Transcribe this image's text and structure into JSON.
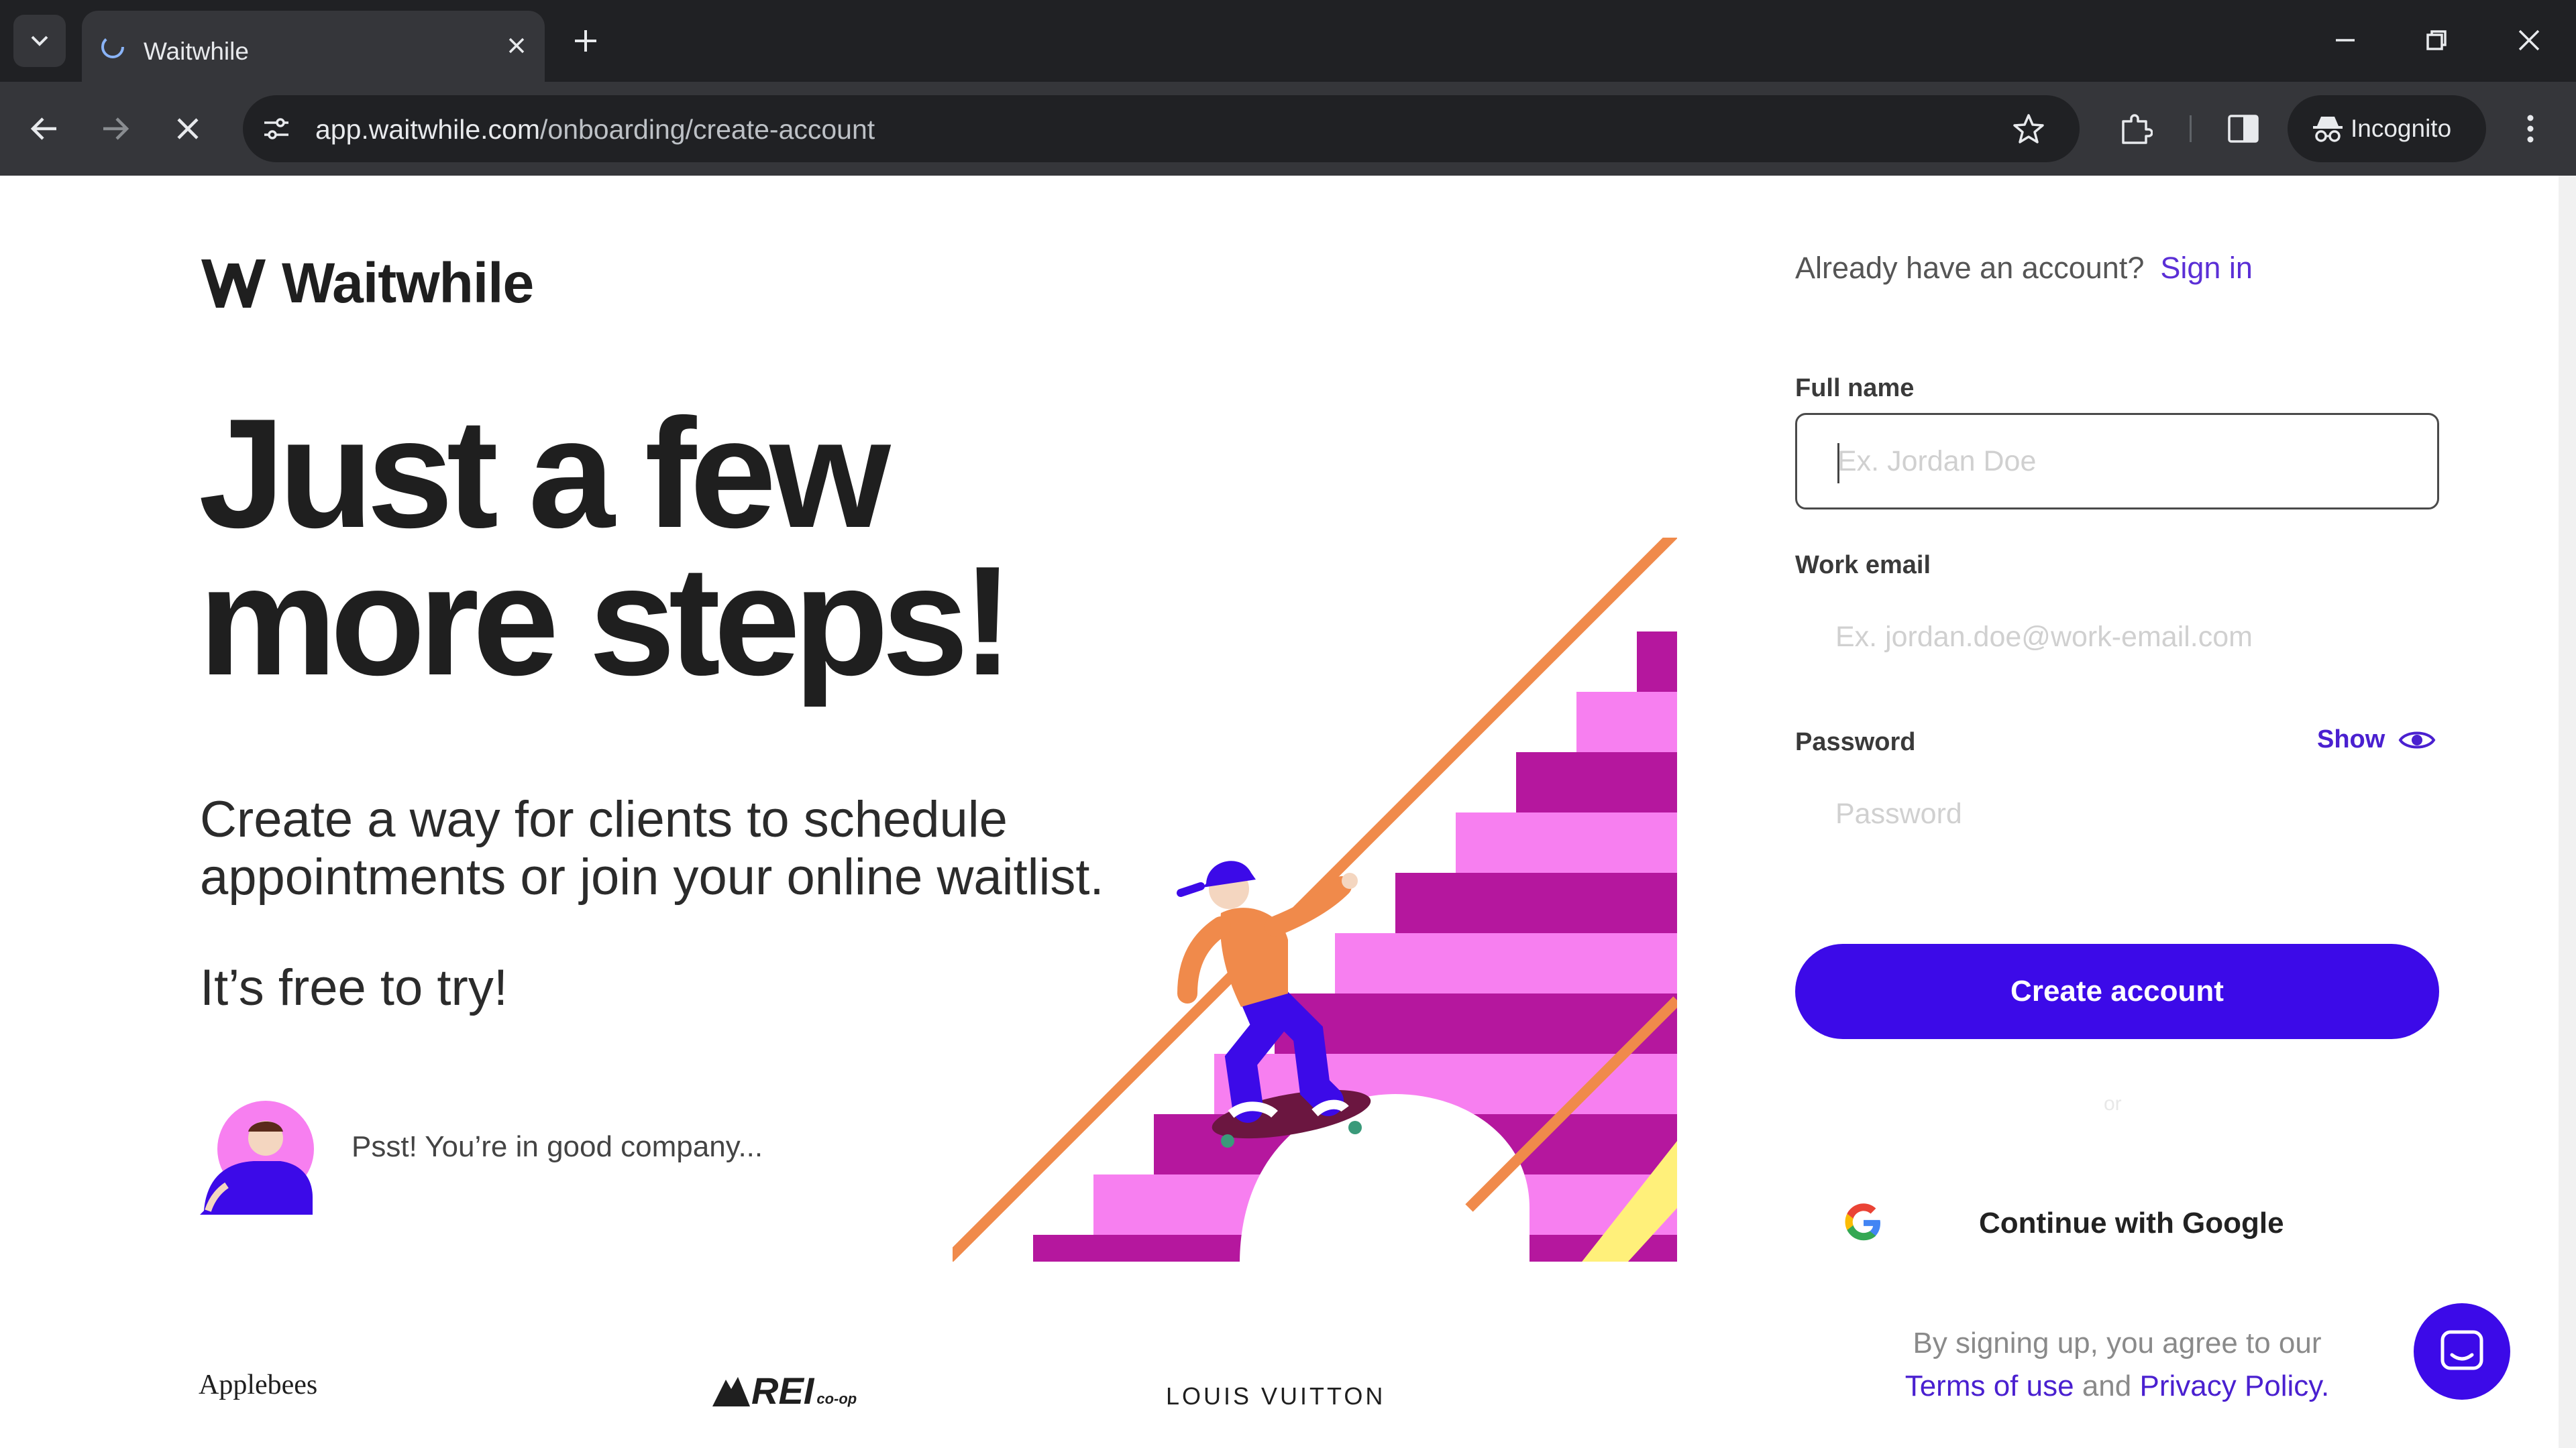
{
  "browser": {
    "tab_title": "Waitwhile",
    "url_domain": "app.waitwhile.com",
    "url_path": "/onboarding/create-account",
    "profile_label": "Incognito"
  },
  "hero": {
    "brand_name": "Waitwhile",
    "headline_line1": "Just a few",
    "headline_line2": "more steps!",
    "subtext_line1": "Create a way for clients to schedule",
    "subtext_line2": "appointments or join your online waitlist.",
    "free_text": "It’s free to try!",
    "company_text": "Psst! You’re in good company..."
  },
  "brands": {
    "applebees": "Applebees",
    "rei": "REI",
    "rei_sub": "co-op",
    "louis_vuitton": "LOUIS VUITTON"
  },
  "form": {
    "already_text": "Already have an account?",
    "sign_in_link": "Sign in",
    "full_name_label": "Full name",
    "full_name_placeholder": "Ex. Jordan Doe",
    "full_name_value": "",
    "email_label": "Work email",
    "email_placeholder": "Ex. jordan.doe@work-email.com",
    "email_value": "",
    "password_label": "Password",
    "password_placeholder": "Password",
    "password_value": "",
    "show_label": "Show",
    "create_button": "Create account",
    "or_text": "or",
    "google_button": "Continue with Google",
    "terms_prefix": "By signing up, you agree to our",
    "terms_link": "Terms of use",
    "terms_and": "and",
    "privacy_link": "Privacy Policy."
  },
  "colors": {
    "primary": "#3c0ae8",
    "link": "#5b2fd6",
    "text_dark": "#1f1f1f",
    "magenta": "#b5179e",
    "pink": "#f77ff0",
    "orange": "#f08a4b",
    "yellow": "#fff07a"
  },
  "icons": {
    "tab_list": "chevron-down-icon",
    "tab_loading": "loading-spinner-icon",
    "tab_close": "close-icon",
    "new_tab": "plus-icon",
    "back": "back-arrow-icon",
    "forward": "forward-arrow-icon",
    "stop": "close-icon",
    "site_info": "tune-icon",
    "bookmark": "star-icon",
    "extensions": "puzzle-icon",
    "side_panel": "side-panel-icon",
    "incognito": "incognito-icon",
    "menu": "kebab-menu-icon",
    "password_visibility": "eye-icon",
    "google": "google-g-icon",
    "chat": "chat-bubble-icon"
  }
}
